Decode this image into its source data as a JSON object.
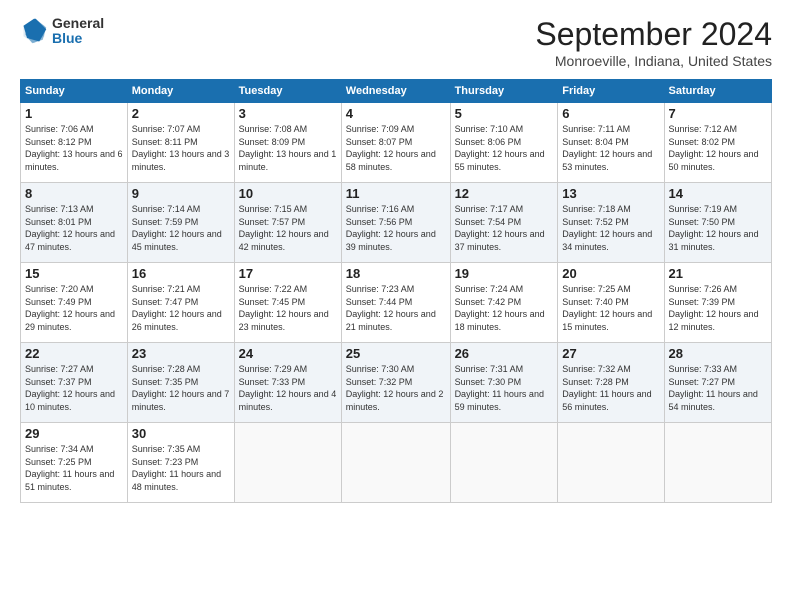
{
  "header": {
    "logo_general": "General",
    "logo_blue": "Blue",
    "month_title": "September 2024",
    "location": "Monroeville, Indiana, United States"
  },
  "calendar": {
    "days_of_week": [
      "Sunday",
      "Monday",
      "Tuesday",
      "Wednesday",
      "Thursday",
      "Friday",
      "Saturday"
    ],
    "weeks": [
      [
        {
          "day": 1,
          "sunrise": "7:06 AM",
          "sunset": "8:12 PM",
          "daylight": "13 hours and 6 minutes."
        },
        {
          "day": 2,
          "sunrise": "7:07 AM",
          "sunset": "8:11 PM",
          "daylight": "13 hours and 3 minutes."
        },
        {
          "day": 3,
          "sunrise": "7:08 AM",
          "sunset": "8:09 PM",
          "daylight": "13 hours and 1 minute."
        },
        {
          "day": 4,
          "sunrise": "7:09 AM",
          "sunset": "8:07 PM",
          "daylight": "12 hours and 58 minutes."
        },
        {
          "day": 5,
          "sunrise": "7:10 AM",
          "sunset": "8:06 PM",
          "daylight": "12 hours and 55 minutes."
        },
        {
          "day": 6,
          "sunrise": "7:11 AM",
          "sunset": "8:04 PM",
          "daylight": "12 hours and 53 minutes."
        },
        {
          "day": 7,
          "sunrise": "7:12 AM",
          "sunset": "8:02 PM",
          "daylight": "12 hours and 50 minutes."
        }
      ],
      [
        {
          "day": 8,
          "sunrise": "7:13 AM",
          "sunset": "8:01 PM",
          "daylight": "12 hours and 47 minutes."
        },
        {
          "day": 9,
          "sunrise": "7:14 AM",
          "sunset": "7:59 PM",
          "daylight": "12 hours and 45 minutes."
        },
        {
          "day": 10,
          "sunrise": "7:15 AM",
          "sunset": "7:57 PM",
          "daylight": "12 hours and 42 minutes."
        },
        {
          "day": 11,
          "sunrise": "7:16 AM",
          "sunset": "7:56 PM",
          "daylight": "12 hours and 39 minutes."
        },
        {
          "day": 12,
          "sunrise": "7:17 AM",
          "sunset": "7:54 PM",
          "daylight": "12 hours and 37 minutes."
        },
        {
          "day": 13,
          "sunrise": "7:18 AM",
          "sunset": "7:52 PM",
          "daylight": "12 hours and 34 minutes."
        },
        {
          "day": 14,
          "sunrise": "7:19 AM",
          "sunset": "7:50 PM",
          "daylight": "12 hours and 31 minutes."
        }
      ],
      [
        {
          "day": 15,
          "sunrise": "7:20 AM",
          "sunset": "7:49 PM",
          "daylight": "12 hours and 29 minutes."
        },
        {
          "day": 16,
          "sunrise": "7:21 AM",
          "sunset": "7:47 PM",
          "daylight": "12 hours and 26 minutes."
        },
        {
          "day": 17,
          "sunrise": "7:22 AM",
          "sunset": "7:45 PM",
          "daylight": "12 hours and 23 minutes."
        },
        {
          "day": 18,
          "sunrise": "7:23 AM",
          "sunset": "7:44 PM",
          "daylight": "12 hours and 21 minutes."
        },
        {
          "day": 19,
          "sunrise": "7:24 AM",
          "sunset": "7:42 PM",
          "daylight": "12 hours and 18 minutes."
        },
        {
          "day": 20,
          "sunrise": "7:25 AM",
          "sunset": "7:40 PM",
          "daylight": "12 hours and 15 minutes."
        },
        {
          "day": 21,
          "sunrise": "7:26 AM",
          "sunset": "7:39 PM",
          "daylight": "12 hours and 12 minutes."
        }
      ],
      [
        {
          "day": 22,
          "sunrise": "7:27 AM",
          "sunset": "7:37 PM",
          "daylight": "12 hours and 10 minutes."
        },
        {
          "day": 23,
          "sunrise": "7:28 AM",
          "sunset": "7:35 PM",
          "daylight": "12 hours and 7 minutes."
        },
        {
          "day": 24,
          "sunrise": "7:29 AM",
          "sunset": "7:33 PM",
          "daylight": "12 hours and 4 minutes."
        },
        {
          "day": 25,
          "sunrise": "7:30 AM",
          "sunset": "7:32 PM",
          "daylight": "12 hours and 2 minutes."
        },
        {
          "day": 26,
          "sunrise": "7:31 AM",
          "sunset": "7:30 PM",
          "daylight": "11 hours and 59 minutes."
        },
        {
          "day": 27,
          "sunrise": "7:32 AM",
          "sunset": "7:28 PM",
          "daylight": "11 hours and 56 minutes."
        },
        {
          "day": 28,
          "sunrise": "7:33 AM",
          "sunset": "7:27 PM",
          "daylight": "11 hours and 54 minutes."
        }
      ],
      [
        {
          "day": 29,
          "sunrise": "7:34 AM",
          "sunset": "7:25 PM",
          "daylight": "11 hours and 51 minutes."
        },
        {
          "day": 30,
          "sunrise": "7:35 AM",
          "sunset": "7:23 PM",
          "daylight": "11 hours and 48 minutes."
        },
        null,
        null,
        null,
        null,
        null
      ]
    ]
  }
}
